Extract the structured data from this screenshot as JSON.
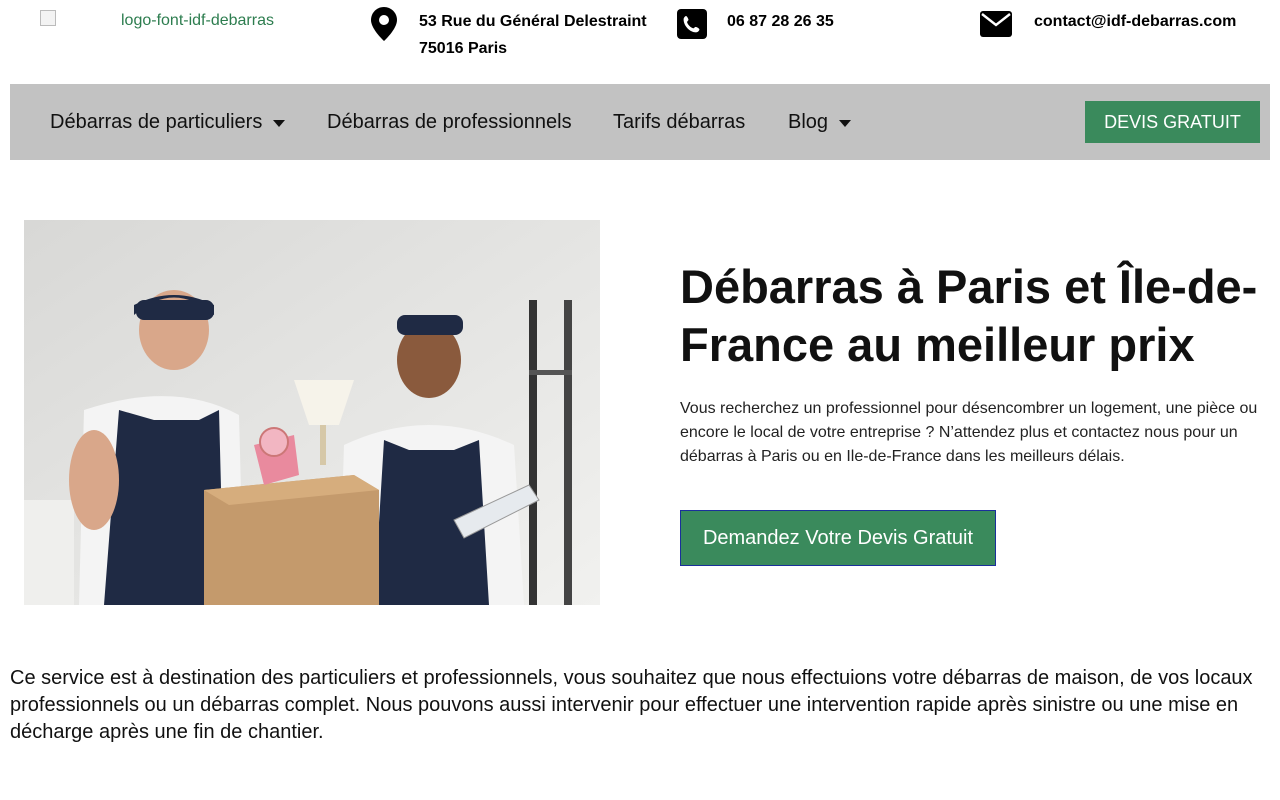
{
  "header": {
    "logo_alt": "logo-font-idf-debarras",
    "address_line1": "53 Rue du Général Delestraint",
    "address_line2": "75016 Paris",
    "phone": "06 87 28 26 35",
    "email": "contact@idf-debarras.com"
  },
  "nav": {
    "items": [
      {
        "label": "Débarras de particuliers",
        "has_dropdown": true
      },
      {
        "label": "Débarras de professionnels",
        "has_dropdown": false
      },
      {
        "label": "Tarifs débarras",
        "has_dropdown": false
      },
      {
        "label": "Blog",
        "has_dropdown": true
      }
    ],
    "cta_label": "DEVIS GRATUIT"
  },
  "hero": {
    "image_alt": "Deux déménageurs en salopette avec un carton",
    "title": "Débarras à Paris et Île-de-France au meilleur prix",
    "text": "Vous recherchez un professionnel pour désencombrer un logement, une pièce ou encore le local de votre entreprise ? N’attendez plus et contactez nous pour un débarras à Paris ou en Ile-de-France dans les meilleurs délais.",
    "cta_label": "Demandez Votre Devis Gratuit"
  },
  "lead": {
    "text": "Ce service est à destination des particuliers et professionnels, vous souhaitez que nous effectuions votre débarras de maison, de vos locaux professionnels ou un débarras complet. Nous pouvons aussi intervenir pour effectuer une intervention rapide après sinistre ou une mise en décharge après une fin de chantier."
  },
  "colors": {
    "brand_green": "#3a8a5c",
    "nav_bg": "#c2c2c2",
    "logo_text": "#2d7d4f"
  },
  "icons": [
    "map-pin-icon",
    "phone-icon",
    "envelope-icon",
    "caret-down-icon"
  ]
}
